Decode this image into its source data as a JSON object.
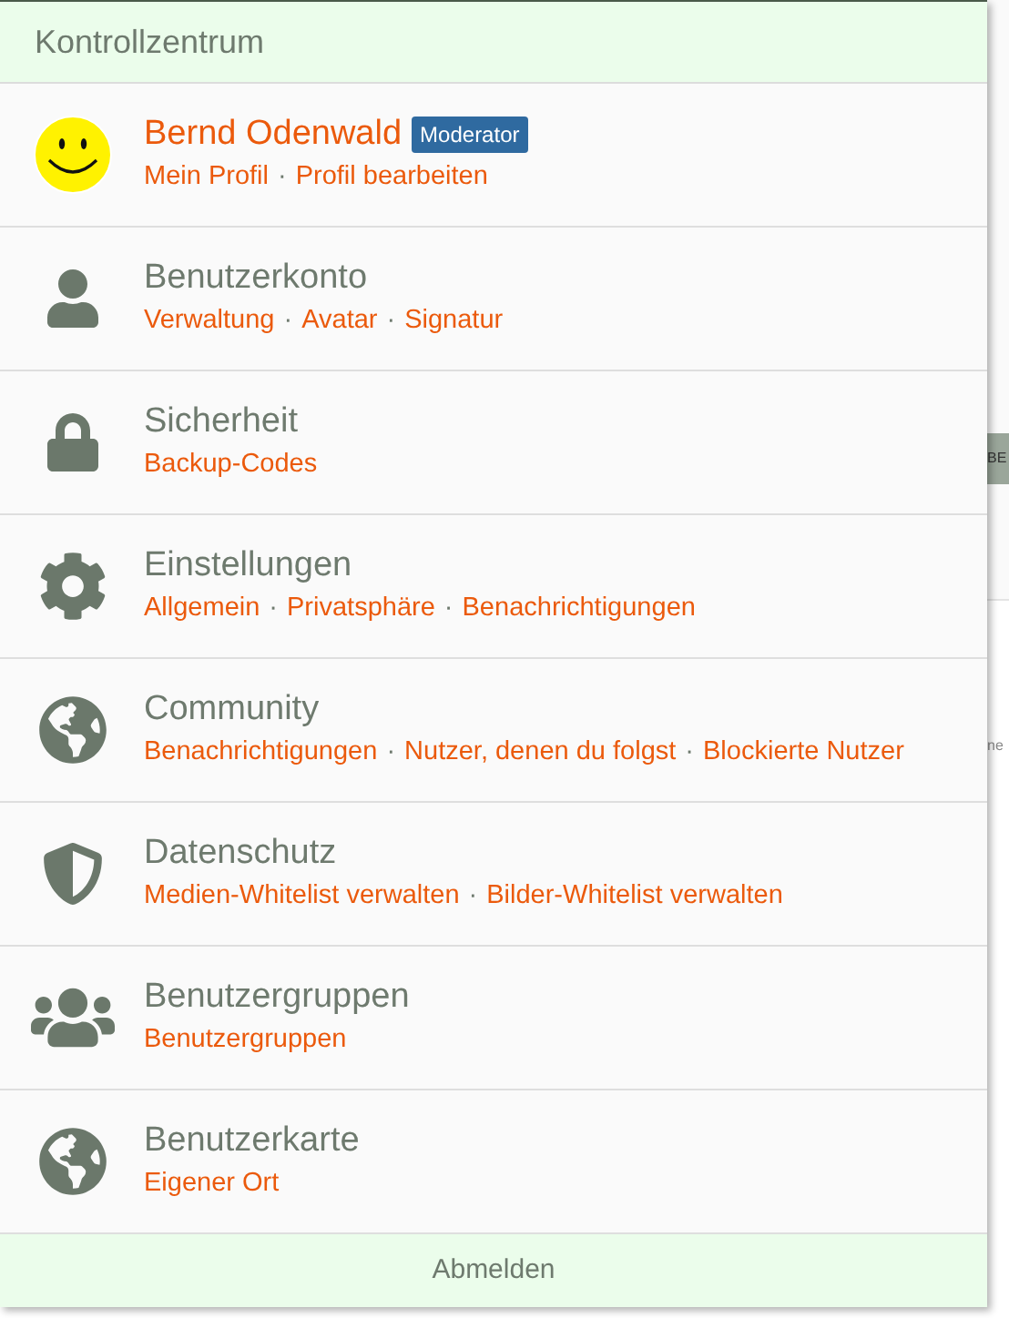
{
  "title": "Kontrollzentrum",
  "items": [
    {
      "kind": "smiley",
      "title": "Bernd Odenwald",
      "title_is_link": true,
      "badge": "Moderator",
      "links": [
        "Mein Profil",
        "Profil bearbeiten"
      ]
    },
    {
      "kind": "user",
      "title": "Benutzerkonto",
      "title_is_link": false,
      "links": [
        "Verwaltung",
        "Avatar",
        "Signatur"
      ]
    },
    {
      "kind": "lock",
      "title": "Sicherheit",
      "title_is_link": false,
      "links": [
        "Backup-Codes"
      ]
    },
    {
      "kind": "gear",
      "title": "Einstellungen",
      "title_is_link": false,
      "links": [
        "Allgemein",
        "Privatsphäre",
        "Benachrichtigungen"
      ]
    },
    {
      "kind": "globe",
      "title": "Community",
      "title_is_link": false,
      "links": [
        "Benachrichtigungen",
        "Nutzer, denen du folgst",
        "Blockierte Nutzer"
      ]
    },
    {
      "kind": "shield",
      "title": "Datenschutz",
      "title_is_link": false,
      "links": [
        "Medien-Whitelist verwalten",
        "Bilder-Whitelist verwalten"
      ]
    },
    {
      "kind": "users",
      "title": "Benutzergruppen",
      "title_is_link": false,
      "links": [
        "Benutzergruppen"
      ]
    },
    {
      "kind": "globe",
      "title": "Benutzerkarte",
      "title_is_link": false,
      "links": [
        "Eigener Ort"
      ]
    }
  ],
  "footer": "Abmelden",
  "separator": "·",
  "background_fragments": [
    "BE",
    "ne"
  ]
}
